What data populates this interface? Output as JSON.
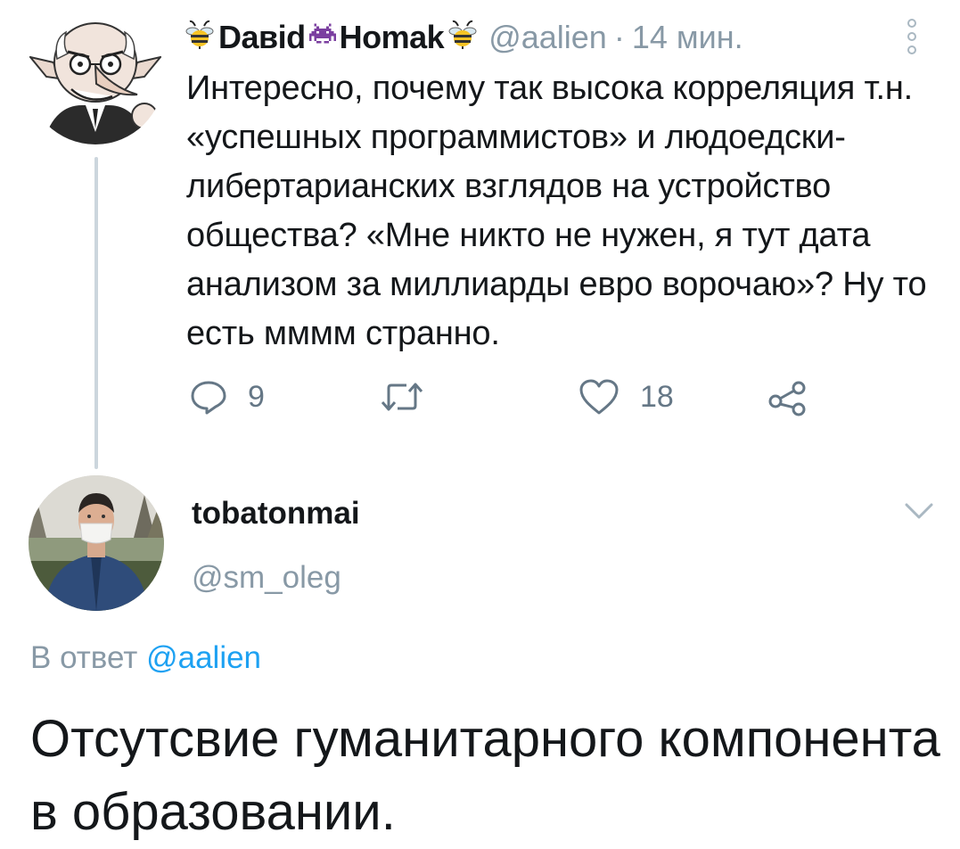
{
  "tweet1": {
    "display_name_part1": "Daвid",
    "display_name_part2": "Homak",
    "handle": "@aalien",
    "separator": "·",
    "time": "14 мин.",
    "text": "Интересно, почему так высока корреляция т.н. «успешных программистов» и людоедски-либертарианских взглядов на устройство общества? «Мне никто не нужен, я тут дата анализом за миллиарды евро ворочаю»? Ну то есть мммм странно.",
    "reply_count": "9",
    "like_count": "18",
    "icons": {
      "emoji_left": "bee-icon",
      "emoji_middle": "space-invader-icon",
      "emoji_right": "bee-icon",
      "more": "more-vertical-icon",
      "reply": "reply-icon",
      "retweet": "retweet-icon",
      "like": "heart-icon",
      "share": "share-icon"
    }
  },
  "tweet2": {
    "display_name": "tobatonmai",
    "handle": "@sm_oleg",
    "reply_prefix": "В ответ",
    "reply_handle": "@aalien",
    "text": "Отсутсвие гуманитарного компонента в образовании.",
    "icons": {
      "menu": "chevron-down-icon"
    }
  },
  "colors": {
    "text": "#14171a",
    "muted": "#8899a6",
    "icon": "#657786",
    "link": "#1da1f2",
    "thread_line": "#ccd6dd"
  }
}
